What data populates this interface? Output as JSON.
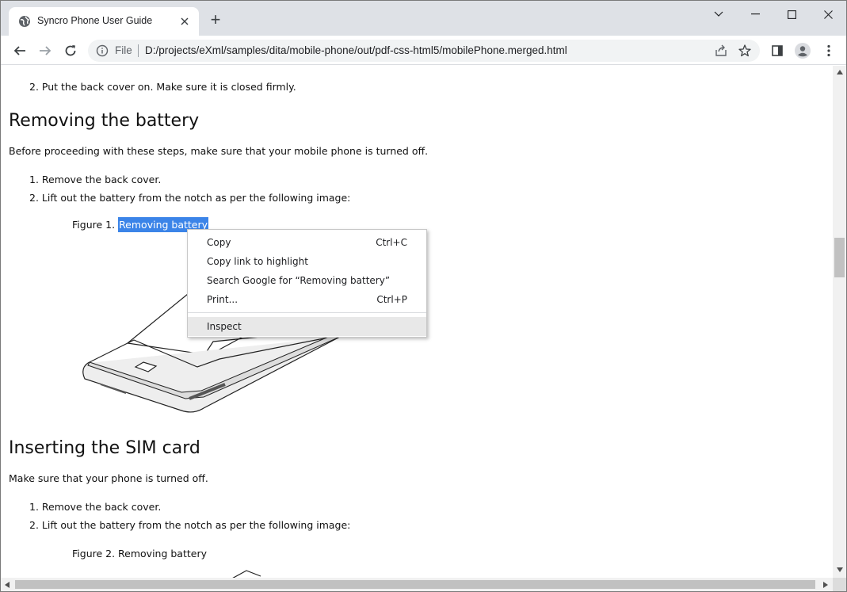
{
  "browser": {
    "tab_title": "Syncro Phone User Guide",
    "new_tab_label": "+",
    "url_scheme": "File",
    "url": "D:/projects/eXml/samples/dita/mobile-phone/out/pdf-css-html5/mobilePhone.merged.html"
  },
  "page": {
    "prev_step": "2. Put the back cover on. Make sure it is closed firmly.",
    "section1": {
      "heading": "Removing the battery",
      "intro": "Before proceeding with these steps, make sure that your mobile phone is turned off.",
      "step1": "1. Remove the back cover.",
      "step2": "2. Lift out the battery from the notch as per the following image:",
      "figure_prefix": "Figure 1.",
      "figure_title": "Removing battery"
    },
    "section2": {
      "heading": "Inserting the SIM card",
      "intro": "Make sure that your phone is turned off.",
      "step1": "1. Remove the back cover.",
      "step2": "2. Lift out the battery from the notch as per the following image:",
      "figure_caption": "Figure 2. Removing battery"
    }
  },
  "context_menu": {
    "copy": "Copy",
    "copy_shortcut": "Ctrl+C",
    "copy_link": "Copy link to highlight",
    "search": "Search Google for “Removing battery”",
    "print": "Print...",
    "print_shortcut": "Ctrl+P",
    "inspect": "Inspect"
  },
  "colors": {
    "selection": "#3b84e8",
    "tabstrip": "#dee1e6",
    "omnibox": "#f1f3f4"
  },
  "icons": [
    "globe-icon",
    "close-icon",
    "back-icon",
    "forward-icon",
    "reload-icon",
    "info-icon",
    "share-icon",
    "star-icon",
    "side-panel-icon",
    "profile-icon",
    "menu-icon",
    "minimize-icon",
    "maximize-icon",
    "chevron-down-icon"
  ]
}
